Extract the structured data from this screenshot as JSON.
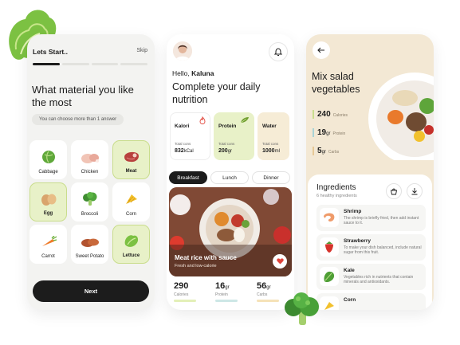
{
  "onboarding": {
    "title": "Lets Start..",
    "skip": "Skip",
    "heading": "What material you like the most",
    "hint": "You can choose more than 1 answer",
    "options": [
      {
        "label": "Cabbage",
        "selected": false,
        "icon": "cabbage-icon"
      },
      {
        "label": "Chicken",
        "selected": false,
        "icon": "chicken-icon"
      },
      {
        "label": "Meat",
        "selected": true,
        "icon": "meat-icon"
      },
      {
        "label": "Egg",
        "selected": true,
        "icon": "egg-icon"
      },
      {
        "label": "Broccoli",
        "selected": false,
        "icon": "broccoli-icon"
      },
      {
        "label": "Corn",
        "selected": false,
        "icon": "corn-icon"
      },
      {
        "label": "Carrot",
        "selected": false,
        "icon": "carrot-icon"
      },
      {
        "label": "Sweet Potato",
        "selected": false,
        "icon": "sweet-potato-icon"
      },
      {
        "label": "Lettuce",
        "selected": true,
        "icon": "lettuce-icon"
      }
    ],
    "next_label": "Next"
  },
  "home": {
    "greeting": "Hello,",
    "user_name": "Kaluna",
    "heading": "Complete your daily nutrition",
    "cards": [
      {
        "name": "Kalori",
        "caption": "Total cons",
        "value": "832",
        "unit": "kCal",
        "icon": "flame-icon"
      },
      {
        "name": "Protein",
        "caption": "Total cons",
        "value": "200",
        "unit": "gr",
        "icon": "leaf-icon"
      },
      {
        "name": "Water",
        "caption": "Total cons",
        "value": "1000",
        "unit": "ml",
        "icon": "drop-icon"
      }
    ],
    "tabs": [
      "Breakfast",
      "Lunch",
      "Dinner"
    ],
    "active_tab": "Breakfast",
    "meal": {
      "title": "Meat rice with sauce",
      "subtitle": "Fresh and low-calorie"
    },
    "stats": [
      {
        "value": "290",
        "unit": "",
        "label": "Calories",
        "color": "#e3f0b8"
      },
      {
        "value": "16",
        "unit": "gr",
        "label": "Protein",
        "color": "#cde7e6"
      },
      {
        "value": "56",
        "unit": "gr",
        "label": "Carbs",
        "color": "#f5e2b8"
      }
    ]
  },
  "detail": {
    "title": "Mix salad vegetables",
    "macros": [
      {
        "value": "240",
        "unit": "",
        "label": "Calories",
        "color": "#c9dd8c"
      },
      {
        "value": "19",
        "unit": "gr",
        "label": "Protein",
        "color": "#a9d3d6"
      },
      {
        "value": "5",
        "unit": "gr",
        "label": "Carbs",
        "color": "#e6c896"
      }
    ],
    "ingredients_title": "Ingredients",
    "ingredients_sub": "6 healthy ingredients",
    "ingredients": [
      {
        "name": "Shrimp",
        "desc": "The shrimp is briefly fried, then add instant sauce to it.",
        "icon": "shrimp-icon"
      },
      {
        "name": "Strawberry",
        "desc": "To make your dish balanced, include natural sugar from this fruit.",
        "icon": "strawberry-icon"
      },
      {
        "name": "Kale",
        "desc": "Vegetables rich in nutrients that contain minerals and antioxidants.",
        "icon": "kale-icon"
      },
      {
        "name": "Corn",
        "desc": "",
        "icon": "corn-icon"
      }
    ]
  },
  "colors": {
    "accent_green": "#e8f1c8",
    "dark": "#1c1c1c",
    "detail_bg": "#f3e8d4"
  }
}
